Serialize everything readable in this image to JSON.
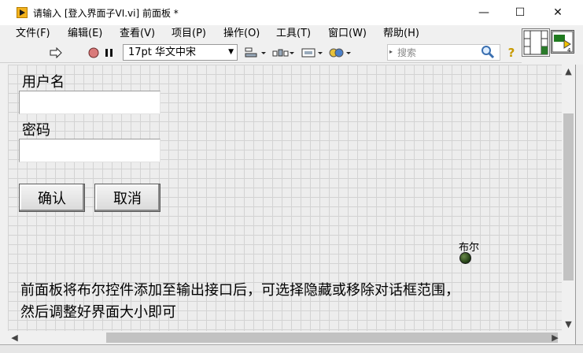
{
  "window": {
    "title": "请输入 [登入界面子VI.vi] 前面板 *",
    "minimize_glyph": "—",
    "maximize_glyph": "☐",
    "close_glyph": "✕"
  },
  "menu": [
    {
      "label": "文件(F)"
    },
    {
      "label": "编辑(E)"
    },
    {
      "label": "查看(V)"
    },
    {
      "label": "项目(P)"
    },
    {
      "label": "操作(O)"
    },
    {
      "label": "工具(T)"
    },
    {
      "label": "窗口(W)"
    },
    {
      "label": "帮助(H)"
    }
  ],
  "toolbar": {
    "run_icon": "run-arrow-icon",
    "abort_icon": "abort-icon",
    "pause_icon": "pause-icon",
    "font_value": "17pt 华文中宋",
    "align_icon": "align-objects-icon",
    "distribute_icon": "distribute-objects-icon",
    "resize_icon": "resize-objects-icon",
    "reorder_icon": "reorder-icon",
    "search_placeholder": "搜索",
    "search_icon": "magnifier-icon",
    "help_glyph": "?"
  },
  "panel": {
    "username_label": "用户名",
    "username_value": "",
    "password_label": "密码",
    "password_value": "",
    "ok_button": "确认",
    "cancel_button": "取消",
    "boolean_label": "布尔",
    "note_line1": "前面板将布尔控件添加至输出接口后，可选择隐藏或移除对话框范围，",
    "note_line2": "然后调整好界面大小即可"
  },
  "colors": {
    "led_off": "#2c4a1e",
    "grid_line": "#d3d3d3",
    "panel_bg": "#ededed"
  }
}
